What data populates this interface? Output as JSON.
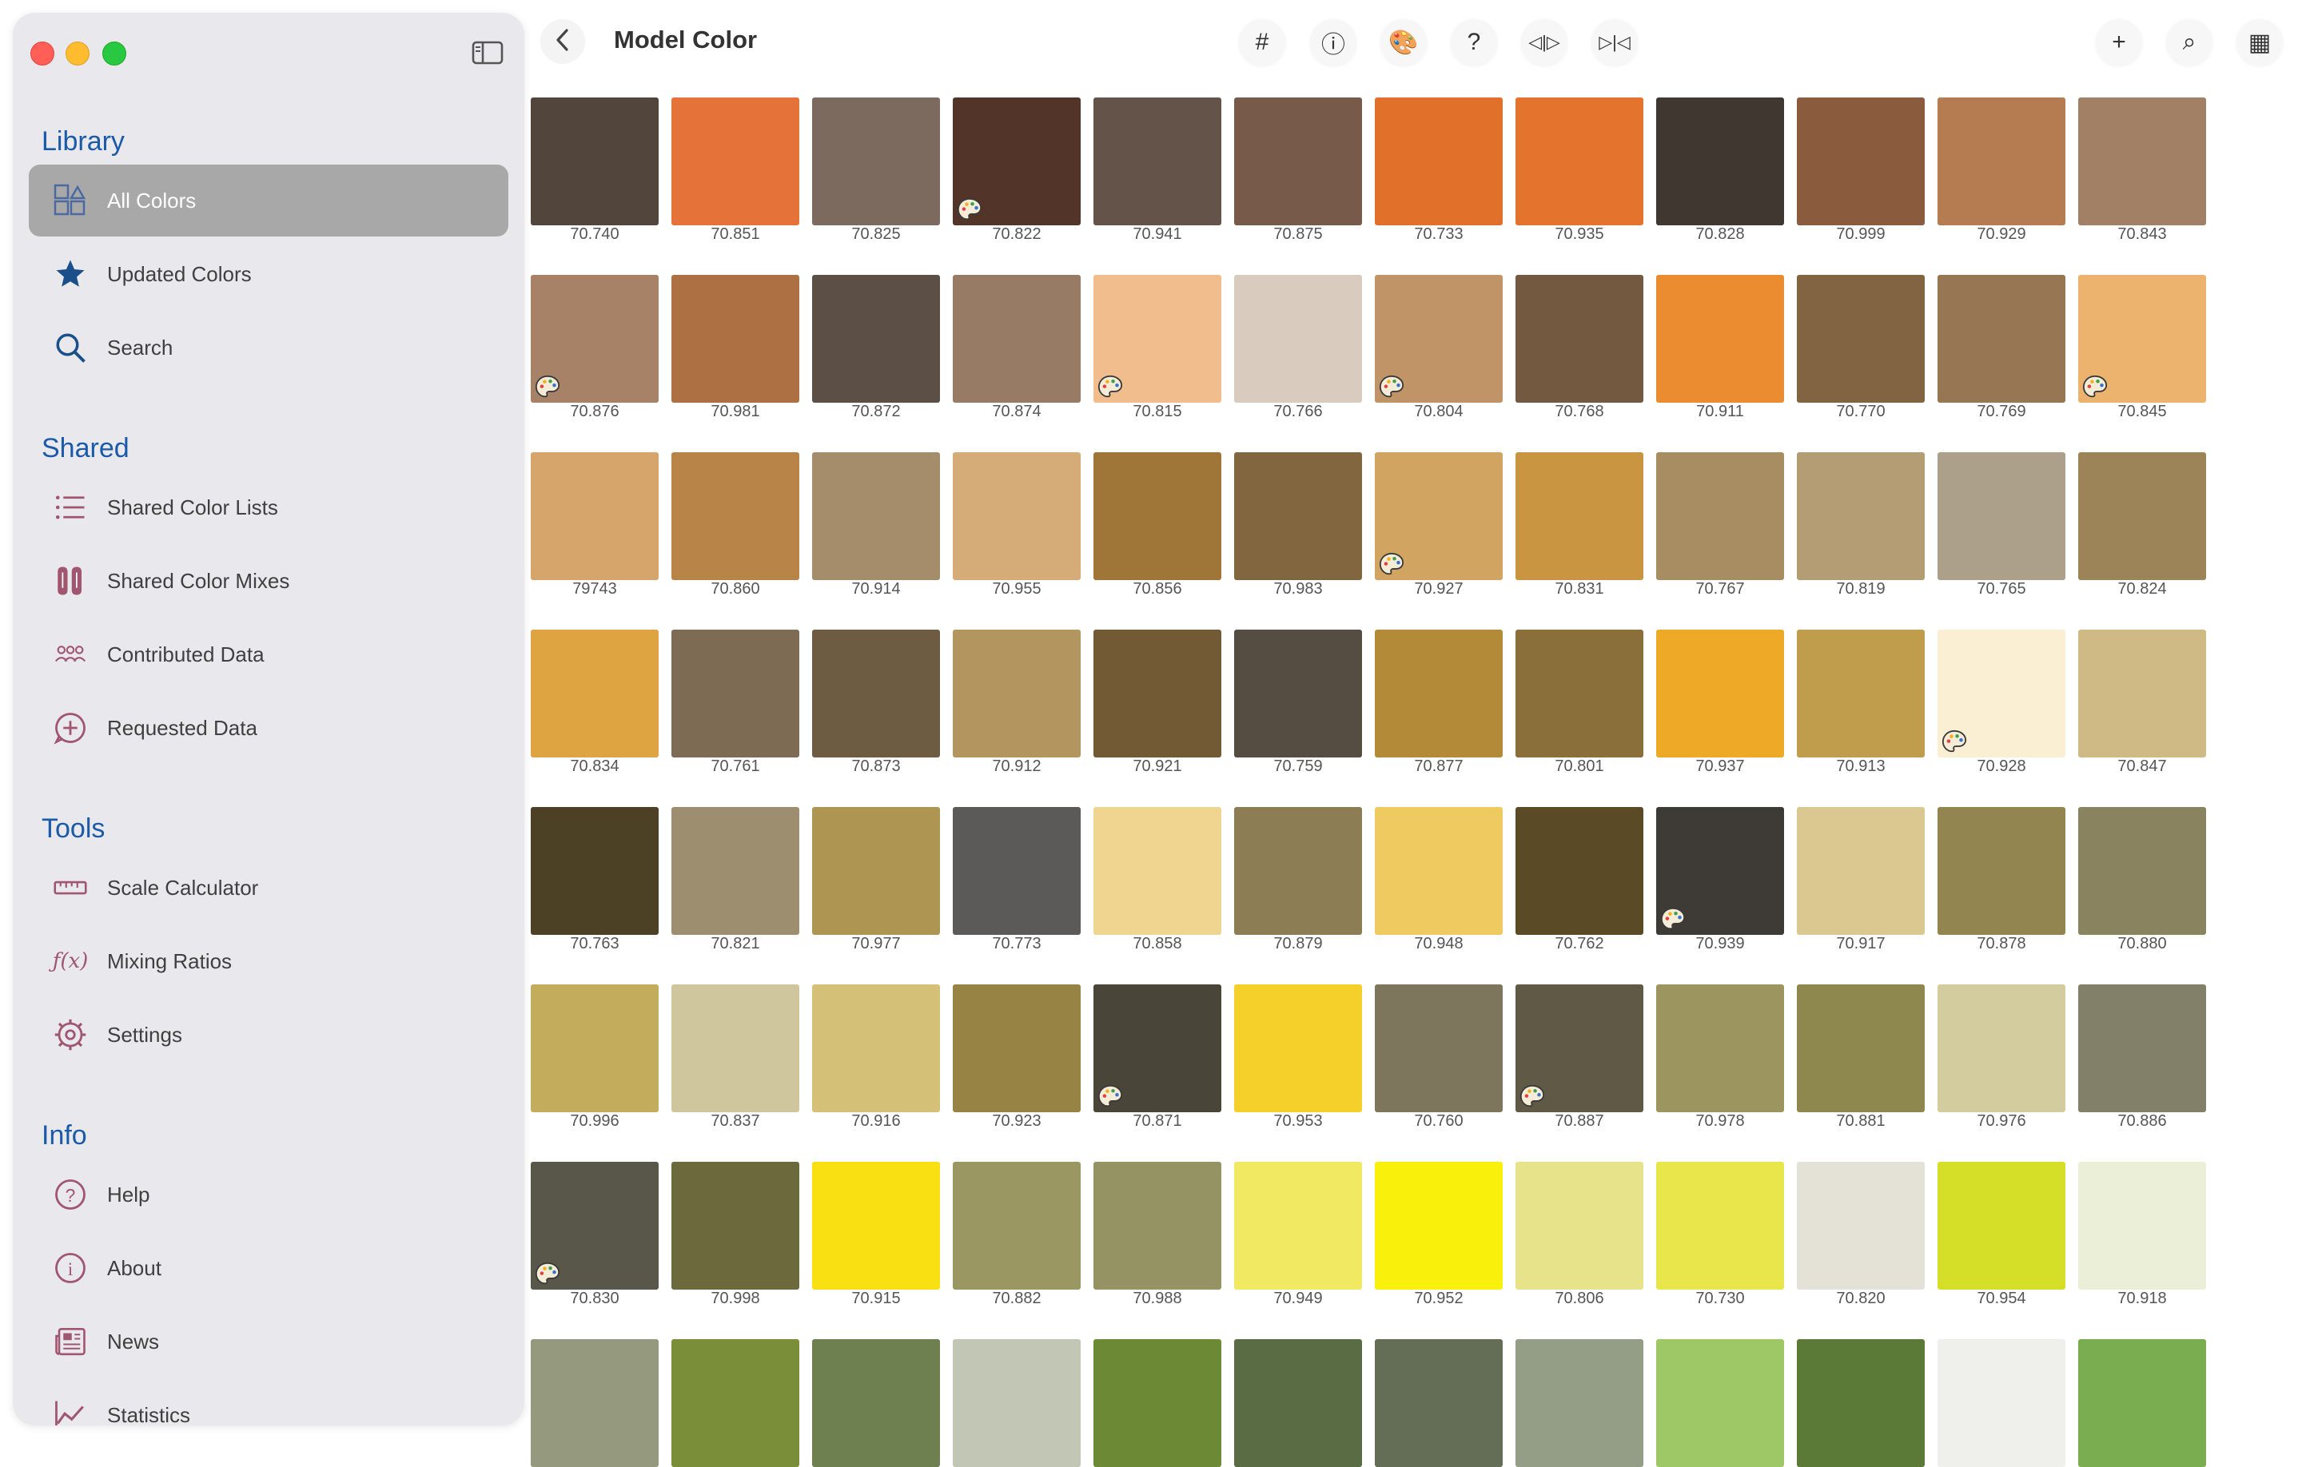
{
  "window": {
    "title": "Model Color"
  },
  "sidebar": {
    "sections": [
      {
        "title": "Library",
        "items": [
          {
            "label": "All Colors",
            "icon": "palette-grid-icon",
            "selected": true
          },
          {
            "label": "Updated Colors",
            "icon": "star-icon"
          },
          {
            "label": "Search",
            "icon": "search-icon"
          }
        ]
      },
      {
        "title": "Shared",
        "items": [
          {
            "label": "Shared Color Lists",
            "icon": "list-icon"
          },
          {
            "label": "Shared Color Mixes",
            "icon": "test-tubes-icon"
          },
          {
            "label": "Contributed Data",
            "icon": "people-icon"
          },
          {
            "label": "Requested Data",
            "icon": "add-bubble-icon"
          }
        ]
      },
      {
        "title": "Tools",
        "items": [
          {
            "label": "Scale Calculator",
            "icon": "ruler-icon"
          },
          {
            "label": "Mixing Ratios",
            "icon": "function-icon"
          },
          {
            "label": "Settings",
            "icon": "gear-icon"
          }
        ]
      },
      {
        "title": "Info",
        "items": [
          {
            "label": "Help",
            "icon": "help-icon"
          },
          {
            "label": "About",
            "icon": "info-icon"
          },
          {
            "label": "News",
            "icon": "newspaper-icon"
          },
          {
            "label": "Statistics",
            "icon": "chart-icon"
          }
        ]
      }
    ]
  },
  "toolbar": {
    "back_icon": "chevron-left-icon",
    "center_buttons": [
      {
        "name": "hash-button",
        "glyph": "#"
      },
      {
        "name": "info-button",
        "glyph": "ⓘ"
      },
      {
        "name": "palette-button",
        "glyph": "🎨"
      },
      {
        "name": "help-button",
        "glyph": "?"
      },
      {
        "name": "compare-button",
        "glyph": "◁|▷"
      },
      {
        "name": "mirror-button",
        "glyph": "▷|◁"
      }
    ],
    "right_buttons": [
      {
        "name": "add-button",
        "glyph": "+"
      },
      {
        "name": "search-button",
        "glyph": "⌕"
      },
      {
        "name": "table-view-button",
        "glyph": "▦"
      }
    ]
  },
  "colors": [
    [
      {
        "code": "70.740",
        "hex": "#52453b"
      },
      {
        "code": "70.851",
        "hex": "#e57238"
      },
      {
        "code": "70.825",
        "hex": "#7d6a5e"
      },
      {
        "code": "70.822",
        "hex": "#523429",
        "pal": true
      },
      {
        "code": "70.941",
        "hex": "#645348"
      },
      {
        "code": "70.875",
        "hex": "#785a4a"
      },
      {
        "code": "70.733",
        "hex": "#e1702a"
      },
      {
        "code": "70.935",
        "hex": "#e4732e"
      },
      {
        "code": "70.828",
        "hex": "#413731"
      },
      {
        "code": "70.999",
        "hex": "#8b5b3e"
      },
      {
        "code": "70.929",
        "hex": "#b57b51"
      },
      {
        "code": "70.843",
        "hex": "#a28066"
      }
    ],
    [
      {
        "code": "70.876",
        "hex": "#a88266",
        "pal": true
      },
      {
        "code": "70.981",
        "hex": "#ad7043"
      },
      {
        "code": "70.872",
        "hex": "#5c4f45"
      },
      {
        "code": "70.874",
        "hex": "#977b65"
      },
      {
        "code": "70.815",
        "hex": "#f2bd8c",
        "pal": true
      },
      {
        "code": "70.766",
        "hex": "#d9ccbe"
      },
      {
        "code": "70.804",
        "hex": "#c19467",
        "pal": true
      },
      {
        "code": "70.768",
        "hex": "#72593f"
      },
      {
        "code": "70.911",
        "hex": "#ea8c2f"
      },
      {
        "code": "70.770",
        "hex": "#826443"
      },
      {
        "code": "70.769",
        "hex": "#977653"
      },
      {
        "code": "70.845",
        "hex": "#ecb36e",
        "pal": true
      }
    ],
    [
      {
        "code": "79743",
        "hex": "#d6a56b"
      },
      {
        "code": "70.860",
        "hex": "#b98447"
      },
      {
        "code": "70.914",
        "hex": "#a58d6b"
      },
      {
        "code": "70.955",
        "hex": "#d5ab77"
      },
      {
        "code": "70.856",
        "hex": "#a07538"
      },
      {
        "code": "70.983",
        "hex": "#826640"
      },
      {
        "code": "70.927",
        "hex": "#d2a461",
        "pal": true
      },
      {
        "code": "70.831",
        "hex": "#c99541"
      },
      {
        "code": "70.767",
        "hex": "#a88d63"
      },
      {
        "code": "70.819",
        "hex": "#b49c74"
      },
      {
        "code": "70.765",
        "hex": "#ada08a"
      },
      {
        "code": "70.824",
        "hex": "#9d8358"
      }
    ],
    [
      {
        "code": "70.834",
        "hex": "#dfa442"
      },
      {
        "code": "70.761",
        "hex": "#7d6c53"
      },
      {
        "code": "70.873",
        "hex": "#6e5c42"
      },
      {
        "code": "70.912",
        "hex": "#b2955f"
      },
      {
        "code": "70.921",
        "hex": "#725a34"
      },
      {
        "code": "70.759",
        "hex": "#554c42"
      },
      {
        "code": "70.877",
        "hex": "#b38a37"
      },
      {
        "code": "70.801",
        "hex": "#8b6f3a"
      },
      {
        "code": "70.937",
        "hex": "#eeaa26"
      },
      {
        "code": "70.913",
        "hex": "#c09c4d"
      },
      {
        "code": "70.928",
        "hex": "#fbefd3",
        "pal": true
      },
      {
        "code": "70.847",
        "hex": "#cfb984"
      }
    ],
    [
      {
        "code": "70.763",
        "hex": "#4c4125"
      },
      {
        "code": "70.821",
        "hex": "#9c8e6f"
      },
      {
        "code": "70.977",
        "hex": "#ae9551"
      },
      {
        "code": "70.773",
        "hex": "#5b5a58"
      },
      {
        "code": "70.858",
        "hex": "#f0d591"
      },
      {
        "code": "70.879",
        "hex": "#8c7d55"
      },
      {
        "code": "70.948",
        "hex": "#eeca60"
      },
      {
        "code": "70.762",
        "hex": "#5a4b26"
      },
      {
        "code": "70.939",
        "hex": "#3e3b36",
        "pal": true
      },
      {
        "code": "70.917",
        "hex": "#dbc790"
      },
      {
        "code": "70.878",
        "hex": "#928550"
      },
      {
        "code": "70.880",
        "hex": "#8a8360"
      }
    ],
    [
      {
        "code": "70.996",
        "hex": "#c3ac5b"
      },
      {
        "code": "70.837",
        "hex": "#d0c69d"
      },
      {
        "code": "70.916",
        "hex": "#d5c077"
      },
      {
        "code": "70.923",
        "hex": "#978444"
      },
      {
        "code": "70.871",
        "hex": "#494538",
        "pal": true
      },
      {
        "code": "70.953",
        "hex": "#f5cf2a"
      },
      {
        "code": "70.760",
        "hex": "#7e765c"
      },
      {
        "code": "70.887",
        "hex": "#5f5946",
        "pal": true
      },
      {
        "code": "70.978",
        "hex": "#9d9560"
      },
      {
        "code": "70.881",
        "hex": "#8e884f"
      },
      {
        "code": "70.976",
        "hex": "#d2cc9f"
      },
      {
        "code": "70.886",
        "hex": "#828069"
      }
    ],
    [
      {
        "code": "70.830",
        "hex": "#58574a",
        "pal": true
      },
      {
        "code": "70.998",
        "hex": "#6c6a3c"
      },
      {
        "code": "70.915",
        "hex": "#f8e012"
      },
      {
        "code": "70.882",
        "hex": "#9b9763"
      },
      {
        "code": "70.988",
        "hex": "#959264"
      },
      {
        "code": "70.949",
        "hex": "#f1e962"
      },
      {
        "code": "70.952",
        "hex": "#f9f00c"
      },
      {
        "code": "70.806",
        "hex": "#e6e38b"
      },
      {
        "code": "70.730",
        "hex": "#e8e64a"
      },
      {
        "code": "70.820",
        "hex": "#e4e2d7"
      },
      {
        "code": "70.954",
        "hex": "#d6df27"
      },
      {
        "code": "70.918",
        "hex": "#ecefd7"
      }
    ],
    [
      {
        "code": "",
        "hex": "#959a7f"
      },
      {
        "code": "",
        "hex": "#7a8d39"
      },
      {
        "code": "",
        "hex": "#6e8050"
      },
      {
        "code": "",
        "hex": "#c1c7b4"
      },
      {
        "code": "",
        "hex": "#6c8a36"
      },
      {
        "code": "",
        "hex": "#5a6c44"
      },
      {
        "code": "",
        "hex": "#646d55"
      },
      {
        "code": "",
        "hex": "#949d85"
      },
      {
        "code": "",
        "hex": "#9ec865"
      },
      {
        "code": "",
        "hex": "#5c7a37"
      },
      {
        "code": "",
        "hex": "#eff0ec"
      },
      {
        "code": "",
        "hex": "#79ad4f"
      }
    ]
  ]
}
